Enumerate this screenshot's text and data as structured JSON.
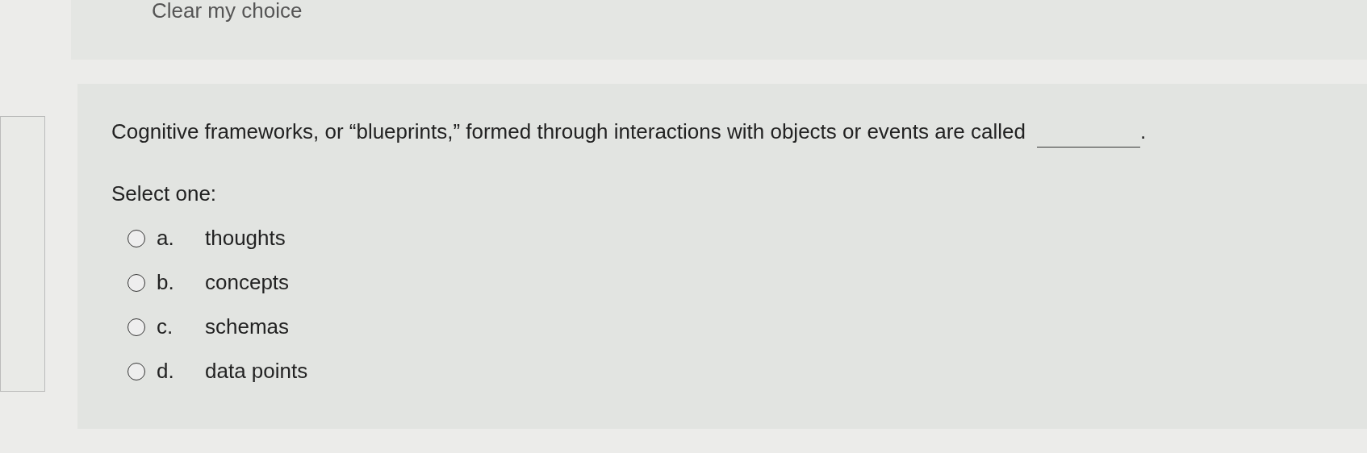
{
  "previous_question": {
    "clear_link": "Clear my choice"
  },
  "question": {
    "text": "Cognitive frameworks, or “blueprints,” formed through interactions with objects or events are called",
    "ending": ".",
    "prompt": "Select one:",
    "options": [
      {
        "letter": "a.",
        "label": "thoughts",
        "selected": false
      },
      {
        "letter": "b.",
        "label": "concepts",
        "selected": false
      },
      {
        "letter": "c.",
        "label": "schemas",
        "selected": false
      },
      {
        "letter": "d.",
        "label": "data points",
        "selected": false
      }
    ]
  }
}
